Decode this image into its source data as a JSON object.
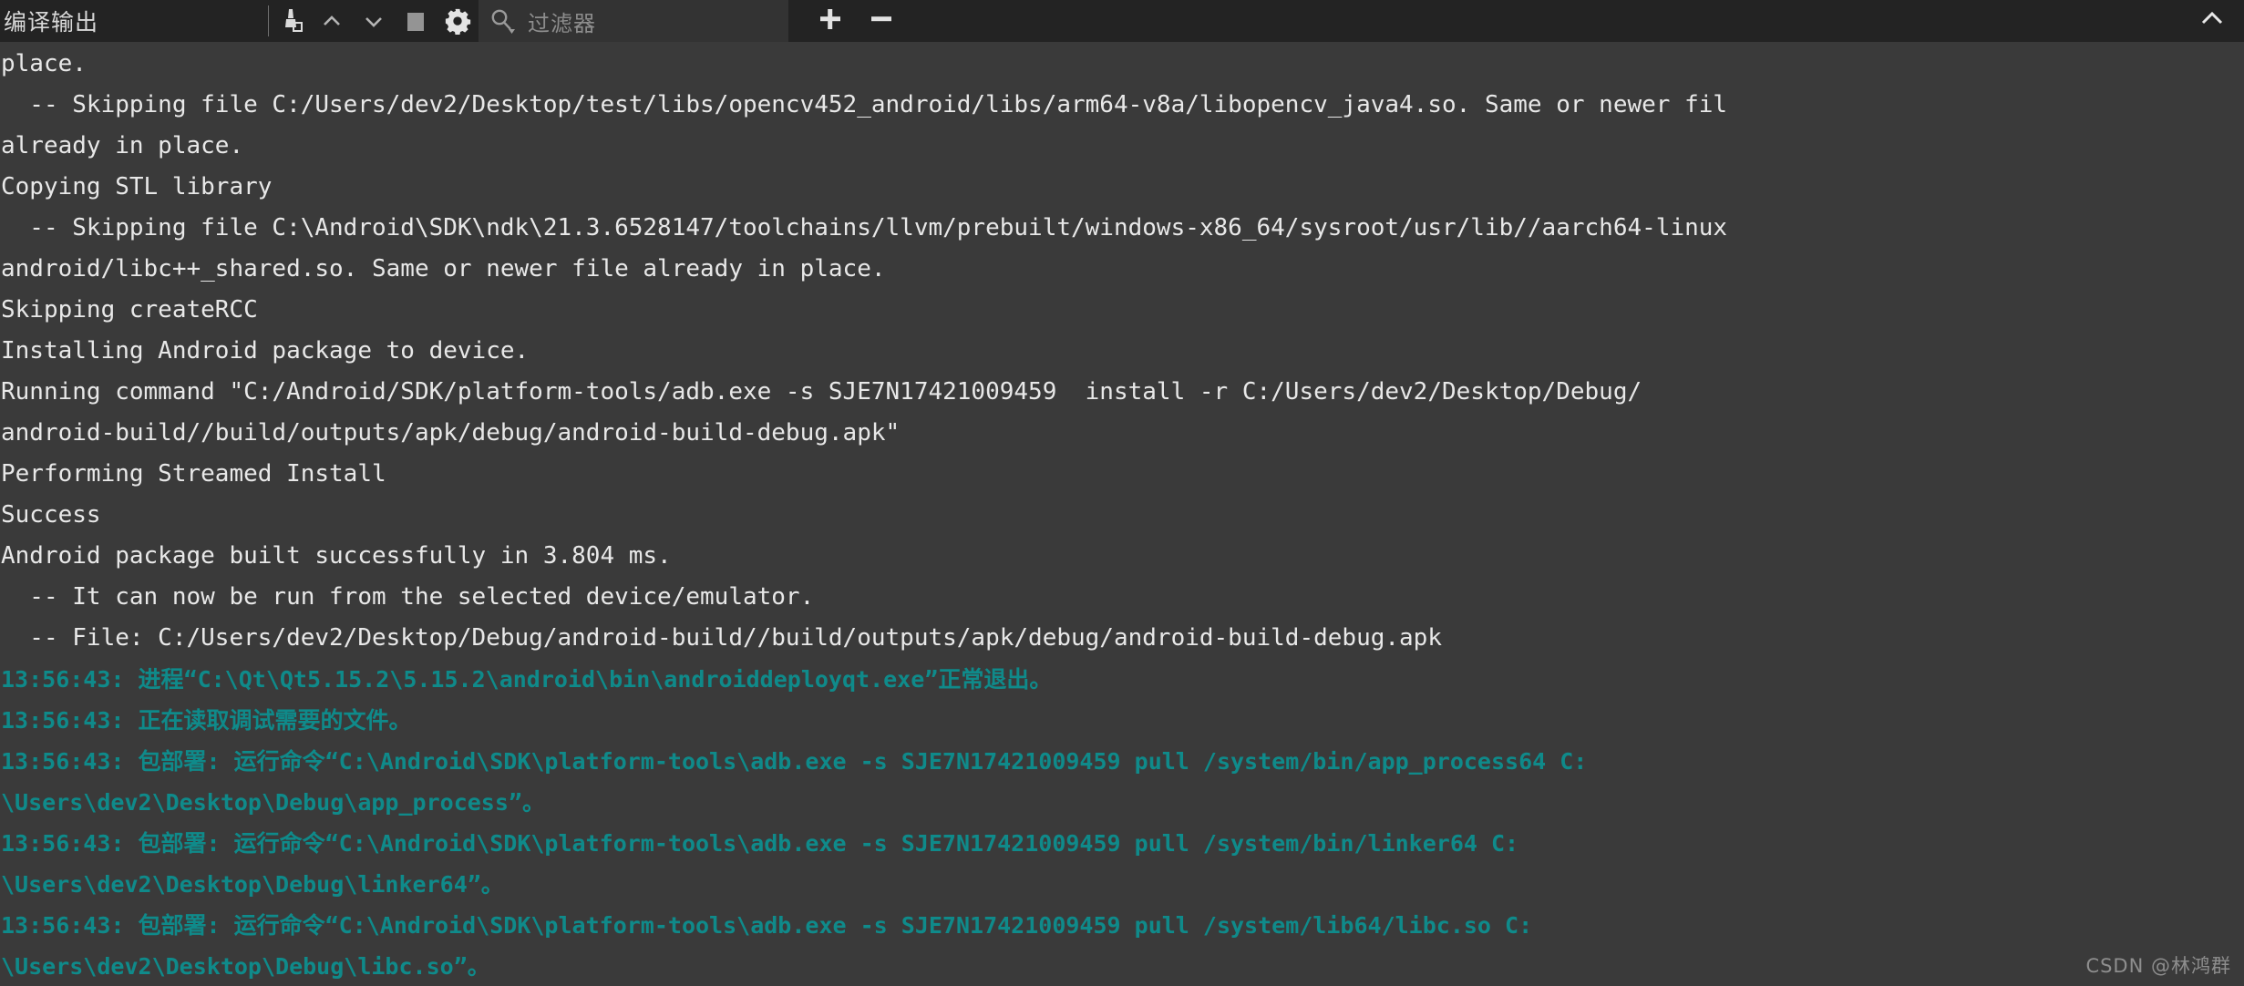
{
  "toolbar": {
    "title": "编译输出",
    "icons": [
      {
        "name": "clear-broom-icon",
        "label": "清除"
      },
      {
        "name": "chevron-up-icon",
        "label": "上一项"
      },
      {
        "name": "chevron-down-icon",
        "label": "下一项"
      },
      {
        "name": "stop-square-icon",
        "label": "停止"
      },
      {
        "name": "gear-icon",
        "label": "设置"
      }
    ],
    "filter": {
      "icon": "search-icon",
      "placeholder": "过滤器",
      "value": ""
    },
    "zoom_in_label": "+",
    "zoom_out_label": "−",
    "collapse_icon": "chevron-up-icon"
  },
  "console": {
    "lines": [
      {
        "text": "place.",
        "style": "plain"
      },
      {
        "text": "  -- Skipping file C:/Users/dev2/Desktop/test/libs/opencv452_android/libs/arm64-v8a/libopencv_java4.so. Same or newer fil",
        "style": "plain"
      },
      {
        "text": "already in place.",
        "style": "plain"
      },
      {
        "text": "Copying STL library",
        "style": "plain"
      },
      {
        "text": "  -- Skipping file C:\\Android\\SDK\\ndk\\21.3.6528147/toolchains/llvm/prebuilt/windows-x86_64/sysroot/usr/lib//aarch64-linux",
        "style": "plain"
      },
      {
        "text": "android/libc++_shared.so. Same or newer file already in place.",
        "style": "plain"
      },
      {
        "text": "Skipping createRCC",
        "style": "plain"
      },
      {
        "text": "Installing Android package to device.",
        "style": "plain"
      },
      {
        "text": "Running command \"C:/Android/SDK/platform-tools/adb.exe -s SJE7N17421009459  install -r C:/Users/dev2/Desktop/Debug/",
        "style": "plain"
      },
      {
        "text": "android-build//build/outputs/apk/debug/android-build-debug.apk\"",
        "style": "plain"
      },
      {
        "text": "Performing Streamed Install",
        "style": "plain"
      },
      {
        "text": "Success",
        "style": "plain"
      },
      {
        "text": "Android package built successfully in 3.804 ms.",
        "style": "plain"
      },
      {
        "text": "  -- It can now be run from the selected device/emulator.",
        "style": "plain"
      },
      {
        "text": "  -- File: C:/Users/dev2/Desktop/Debug/android-build//build/outputs/apk/debug/android-build-debug.apk",
        "style": "plain"
      },
      {
        "text": "13:56:43: 进程“C:\\Qt\\Qt5.15.2\\5.15.2\\android\\bin\\androiddeployqt.exe”正常退出。",
        "style": "teal"
      },
      {
        "text": "13:56:43: 正在读取调试需要的文件。",
        "style": "teal"
      },
      {
        "text": "13:56:43: 包部署: 运行命令“C:\\Android\\SDK\\platform-tools\\adb.exe -s SJE7N17421009459 pull /system/bin/app_process64 C:",
        "style": "teal"
      },
      {
        "text": "\\Users\\dev2\\Desktop\\Debug\\app_process”。",
        "style": "teal"
      },
      {
        "text": "13:56:43: 包部署: 运行命令“C:\\Android\\SDK\\platform-tools\\adb.exe -s SJE7N17421009459 pull /system/bin/linker64 C:",
        "style": "teal"
      },
      {
        "text": "\\Users\\dev2\\Desktop\\Debug\\linker64”。",
        "style": "teal"
      },
      {
        "text": "13:56:43: 包部署: 运行命令“C:\\Android\\SDK\\platform-tools\\adb.exe -s SJE7N17421009459 pull /system/lib64/libc.so C:",
        "style": "teal"
      },
      {
        "text": "\\Users\\dev2\\Desktop\\Debug\\libc.so”。",
        "style": "teal"
      }
    ]
  },
  "watermark": "CSDN @林鸿群",
  "colors": {
    "toolbar_bg": "#232323",
    "console_bg": "#3a3a3a",
    "text": "#e8e8e8",
    "teal": "#0f8a8a",
    "filter_bg": "#333333",
    "icon": "#d0d0d0"
  }
}
